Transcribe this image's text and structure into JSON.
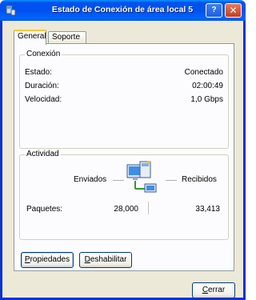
{
  "window": {
    "title": "Estado de Conexión de área local 5",
    "help_label": "?",
    "close_label": "✕"
  },
  "tabs": [
    {
      "label": "General",
      "active": true
    },
    {
      "label": "Soporte",
      "active": false
    }
  ],
  "connection": {
    "title": "Conexión",
    "rows": [
      {
        "label": "Estado:",
        "value": "Conectado"
      },
      {
        "label": "Duración:",
        "value": "02:00:49"
      },
      {
        "label": "Velocidad:",
        "value": "1,0 Gbps"
      }
    ]
  },
  "activity": {
    "title": "Actividad",
    "sent_label": "Enviados",
    "received_label": "Recibidos",
    "packets_label": "Paquetes:",
    "packets_sent": "28,000",
    "packets_received": "33,413",
    "icon": "network-activity-icon"
  },
  "buttons": {
    "properties_first": "P",
    "properties_rest": "ropiedades",
    "disable_first": "D",
    "disable_rest": "eshabilitar",
    "close_first": "C",
    "close_rest": "errar"
  },
  "colors": {
    "titlebar": "#0054e3",
    "window_bg": "#ece9d8",
    "tab_highlight": "#ffc83c"
  }
}
